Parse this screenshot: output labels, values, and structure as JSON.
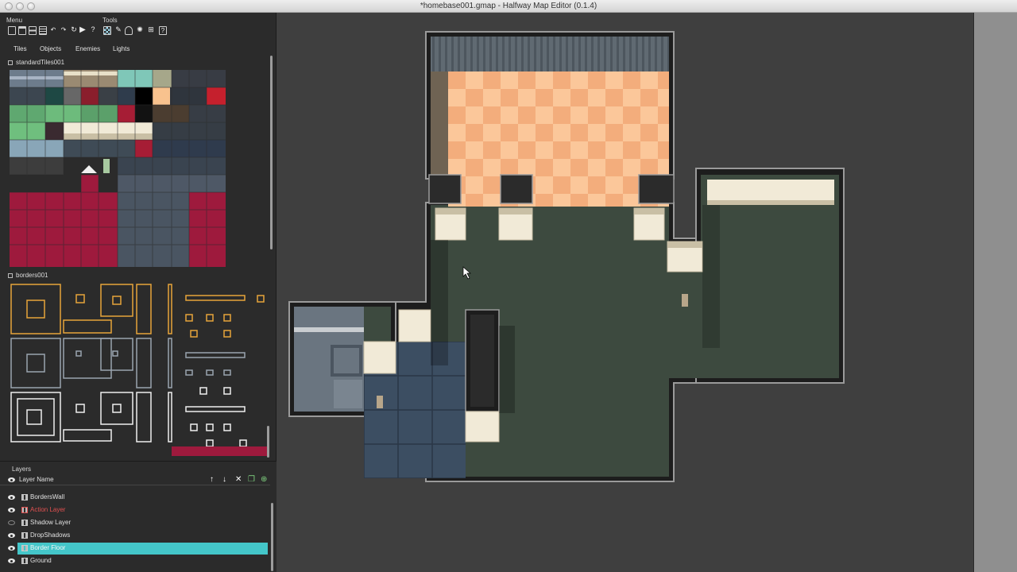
{
  "window": {
    "title": "*homebase001.gmap - Halfway Map Editor (0.1.4)"
  },
  "toolbar": {
    "menu_label": "Menu",
    "tools_label": "Tools",
    "menu_icons": [
      "new-file-icon",
      "open-file-icon",
      "save-icon",
      "save-all-icon",
      "undo-icon",
      "redo-icon",
      "play-icon",
      "help-icon"
    ],
    "tool_icons": [
      "select-tool-icon",
      "brush-tool-icon",
      "enemy-tool-icon",
      "light-tool-icon",
      "camera-tool-icon",
      "grid-tool-icon",
      "info-tool-icon"
    ]
  },
  "tabs": [
    {
      "label": "Tiles",
      "active": true
    },
    {
      "label": "Objects",
      "active": false
    },
    {
      "label": "Enemies",
      "active": false
    },
    {
      "label": "Lights",
      "active": false
    }
  ],
  "tilesets": {
    "standard": {
      "name": "standardTiles001"
    },
    "borders": {
      "name": "borders001"
    }
  },
  "layers": {
    "title": "Layers",
    "header": "Layer Name",
    "items": [
      {
        "name": "BordersWall",
        "visible": true,
        "selected": false,
        "color": "#e0e0e0"
      },
      {
        "name": "Action Layer",
        "visible": true,
        "selected": false,
        "color": "#e05050"
      },
      {
        "name": "Shadow Layer",
        "visible": false,
        "selected": false,
        "color": "#e0e0e0"
      },
      {
        "name": "DropShadows",
        "visible": true,
        "selected": false,
        "color": "#e0e0e0"
      },
      {
        "name": "Border Floor",
        "visible": true,
        "selected": true,
        "color": "#f6f6f6"
      },
      {
        "name": "Ground",
        "visible": true,
        "selected": false,
        "color": "#e0e0e0"
      }
    ],
    "header_buttons": [
      "move-up-icon",
      "move-down-icon",
      "delete-layer-icon",
      "duplicate-layer-icon",
      "add-layer-icon"
    ]
  },
  "colors": {
    "panel_bg": "#2b2b2b",
    "canvas_bg": "#3f3f3f",
    "selection": "#44c6c9",
    "floor_dark": "#3d4a3f",
    "floor_orange_a": "#fbc79a",
    "floor_orange_b": "#f3ad7c",
    "floor_blue": "#3c4e62",
    "wall_cream": "#f1ead7",
    "accent_red": "#9e1a3d"
  }
}
